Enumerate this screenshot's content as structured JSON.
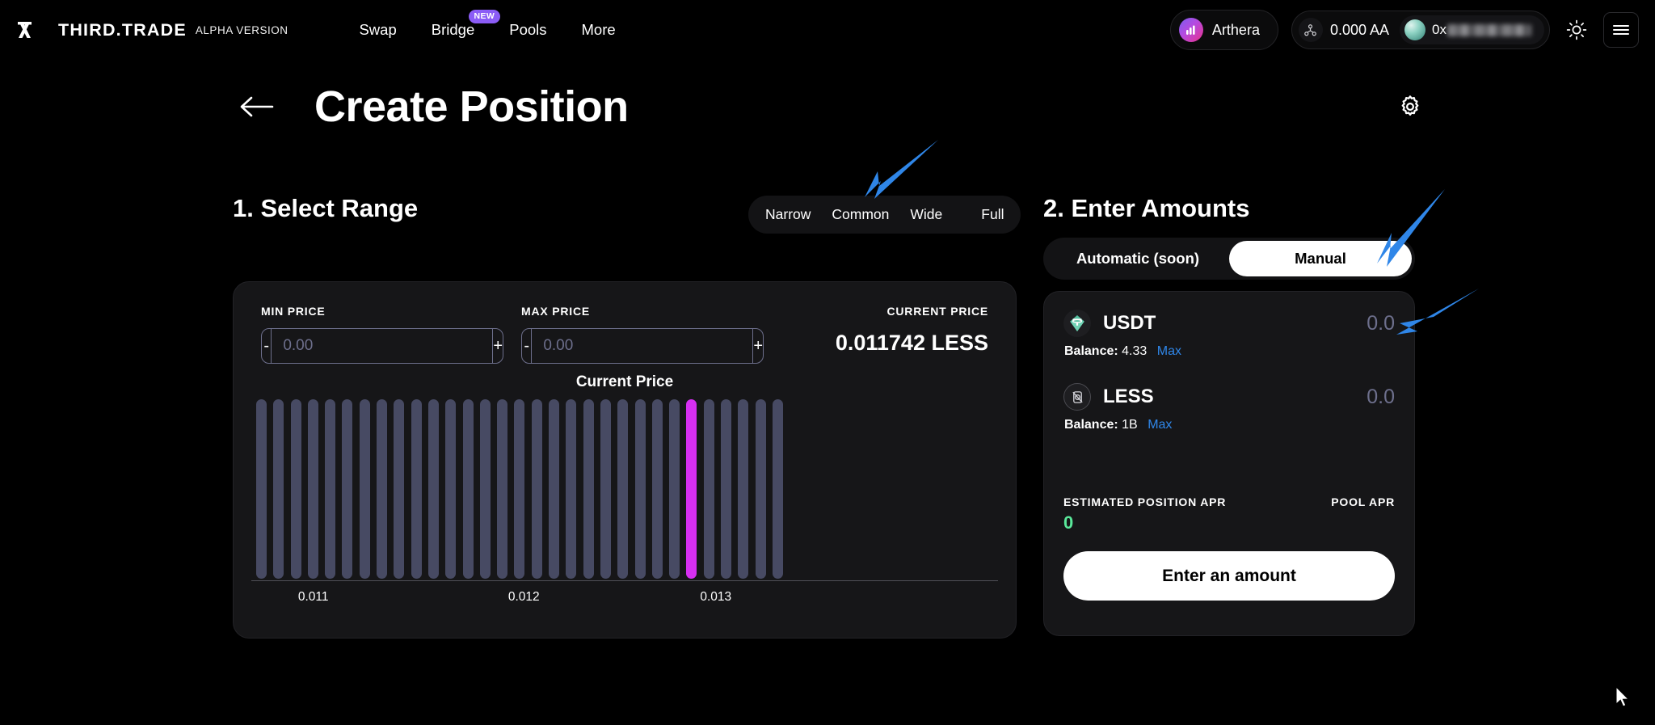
{
  "header": {
    "logo_icon": "third-trade-logo-icon",
    "brand_name": "THIRD.TRADE",
    "alpha_tag": "ALPHA VERSION",
    "nav": [
      {
        "label": "Swap",
        "badge": null
      },
      {
        "label": "Bridge",
        "badge": "NEW"
      },
      {
        "label": "Pools",
        "badge": null
      },
      {
        "label": "More",
        "badge": null
      }
    ],
    "chain": {
      "name": "Arthera",
      "icon": "arthera-chain-icon"
    },
    "wallet": {
      "balance": "0.000 AA",
      "address_prefix": "0x",
      "address_masked": true,
      "network_icon": "network-nodes-icon"
    },
    "theme_toggle_icon": "sun-icon",
    "menu_icon": "hamburger-menu-icon"
  },
  "title_bar": {
    "back_icon": "arrow-left-icon",
    "title": "Create Position",
    "settings_icon": "gear-icon"
  },
  "select_range": {
    "heading": "1. Select Range",
    "tabs": [
      "Narrow",
      "Common",
      "Wide",
      "Full"
    ],
    "min_price": {
      "label": "MIN PRICE",
      "value": "",
      "placeholder": "0.00",
      "minus": "-",
      "plus": "+"
    },
    "max_price": {
      "label": "MAX PRICE",
      "value": "",
      "placeholder": "0.00",
      "minus": "-",
      "plus": "+"
    },
    "current_price": {
      "label": "CURRENT PRICE",
      "value": "0.011742 LESS"
    }
  },
  "enter_amounts": {
    "heading": "2. Enter Amounts",
    "modes": [
      {
        "label": "Automatic (soon)",
        "active": false
      },
      {
        "label": "Manual",
        "active": true
      }
    ],
    "tokens": [
      {
        "symbol": "USDT",
        "icon": "usdt-token-icon",
        "amount": "0.0",
        "balance_label": "Balance:",
        "balance_value": "4.33",
        "max_label": "Max"
      },
      {
        "symbol": "LESS",
        "icon": "less-token-icon",
        "amount": "0.0",
        "balance_label": "Balance:",
        "balance_value": "1B",
        "max_label": "Max"
      }
    ],
    "estimated_apr_label": "ESTIMATED POSITION APR",
    "estimated_apr_value": "0",
    "pool_apr_label": "POOL APR",
    "cta_label": "Enter an amount"
  },
  "chart_data": {
    "type": "bar",
    "title": "Current Price",
    "xlabel": "",
    "ylabel": "",
    "grid": false,
    "legend": false,
    "axis_ticks": [
      {
        "label": "0.011",
        "x_pct": 8.3
      },
      {
        "label": "0.012",
        "x_pct": 36.5
      },
      {
        "label": "0.013",
        "x_pct": 62.2
      }
    ],
    "current_price_index": 25,
    "bar_color": "#474a63",
    "current_bar_color": "#d62ff0",
    "values": [
      100,
      100,
      100,
      100,
      100,
      100,
      100,
      100,
      100,
      100,
      100,
      100,
      100,
      100,
      100,
      100,
      100,
      100,
      100,
      100,
      100,
      100,
      100,
      100,
      100,
      100,
      100,
      100,
      100,
      100,
      100
    ]
  },
  "annotations": [
    {
      "name": "arrow-to-range-tabs",
      "color": "#2f86e8"
    },
    {
      "name": "arrow-to-manual-toggle",
      "color": "#2f86e8"
    },
    {
      "name": "arrow-to-usdt-amount",
      "color": "#2f86e8"
    }
  ],
  "colors": {
    "background": "#000000",
    "card": "#161618",
    "card_border": "#222226",
    "accent_purple": "#8b5cf6",
    "accent_magenta": "#d62ff0",
    "link_blue": "#2f86e8",
    "apr_green": "#5ae89a",
    "muted": "#6d6f8c"
  }
}
